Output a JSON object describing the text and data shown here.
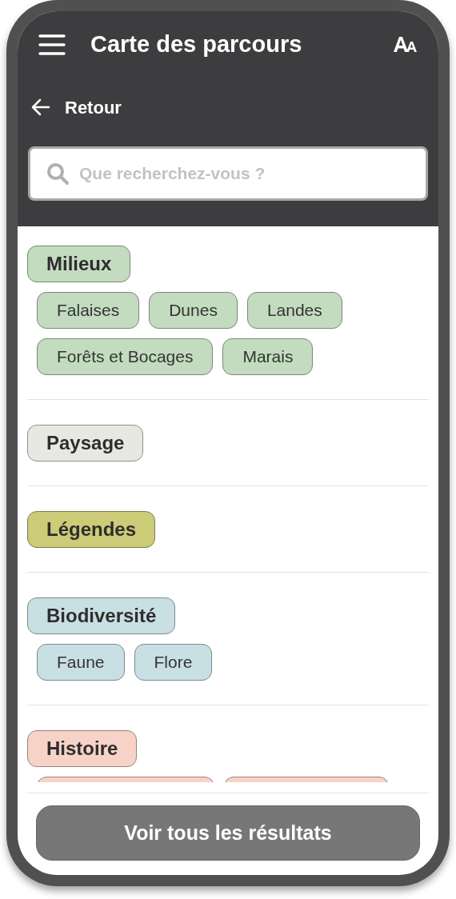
{
  "header": {
    "title": "Carte des parcours",
    "back_label": "Retour",
    "search": {
      "placeholder": "Que recherchez-vous ?"
    }
  },
  "categories": [
    {
      "label": "Milieux",
      "color": "#c3dcbf",
      "items": [
        {
          "label": "Falaises"
        },
        {
          "label": "Dunes"
        },
        {
          "label": "Landes"
        },
        {
          "label": "Forêts et Bocages"
        },
        {
          "label": "Marais"
        }
      ]
    },
    {
      "label": "Paysage",
      "color": "#e8e8e3"
    },
    {
      "label": "Légendes",
      "color": "#cccb77"
    },
    {
      "label": "Biodiversité",
      "color": "#c8dfe3",
      "items": [
        {
          "label": "Faune"
        },
        {
          "label": "Flore"
        }
      ]
    },
    {
      "label": "Histoire",
      "color": "#f7d3c7",
      "items": [
        {
          "kind": "clipped"
        },
        {
          "kind": "clipped"
        }
      ]
    }
  ],
  "footer": {
    "button": "Voir tous les résultats"
  }
}
